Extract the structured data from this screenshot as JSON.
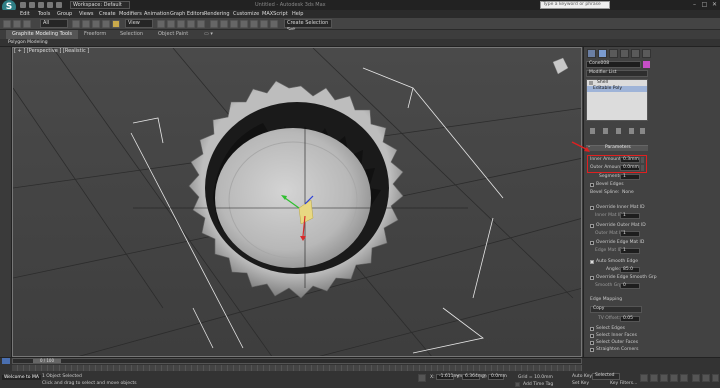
{
  "titlebar": {
    "workspace": "Workspace: Default",
    "title": "Untitled - Autodesk 3ds Max",
    "search_placeholder": "Type a keyword or phrase"
  },
  "menu": [
    "Edit",
    "Tools",
    "Group",
    "Views",
    "Create",
    "Modifiers",
    "Animation",
    "Graph Editors",
    "Rendering",
    "Customize",
    "MAXScript",
    "Help"
  ],
  "toolbar": {
    "filter": "All",
    "ref_coord": "View",
    "selection_set": "Create Selection Set"
  },
  "ribbon": {
    "tabs": [
      "Graphite Modeling Tools",
      "Freeform",
      "Selection",
      "Object Paint"
    ],
    "subtab": "Polygon Modeling"
  },
  "viewport": {
    "label": "[ + ] [Perspective ] [Realistic ]"
  },
  "command_panel": {
    "object_name": "Cone008",
    "modifier_list": "Modifier List",
    "stack": [
      "Shell",
      "Editable Poly"
    ],
    "rollout": "Parameters",
    "inner_amount_label": "Inner Amount:",
    "inner_amount": "0.3mm",
    "outer_amount_label": "Outer Amount:",
    "outer_amount": "0.0mm",
    "segments_label": "Segments:",
    "segments": "1",
    "bevel_edges": "Bevel Edges",
    "bevel_spline_label": "Bevel Spline:",
    "bevel_spline": "None",
    "override_inner": "Override Inner Mat ID",
    "inner_mat_label": "Inner Mat ID:",
    "inner_mat": "1",
    "override_outer": "Override Outer Mat ID",
    "outer_mat_label": "Outer Mat ID:",
    "outer_mat": "1",
    "override_edge": "Override Edge Mat ID",
    "edge_mat_label": "Edge Mat ID:",
    "edge_mat": "1",
    "auto_smooth": "Auto Smooth Edge",
    "angle_label": "Angle:",
    "angle": "85.0",
    "override_smooth": "Override Edge Smooth Grp",
    "smooth_grp_label": "Smooth Grp:",
    "smooth_grp": "0",
    "edge_mapping": "Edge Mapping",
    "edge_mapping_value": "Copy",
    "tv_offset_label": "TV Offset:",
    "tv_offset": "0.05",
    "select_edges": "Select Edges",
    "select_inner": "Select Inner Faces",
    "select_outer": "Select Outer Faces",
    "straighten": "Straighten Corners"
  },
  "status": {
    "time": "0 / 100",
    "welcome": "Welcome to MA",
    "selected": "1 Object Selected",
    "prompt": "Click and drag to select and move objects",
    "x_label": "X:",
    "x": "-1.611mm",
    "y_label": "Y:",
    "y": "6.364mm",
    "z_label": "Z:",
    "z": "0.0mm",
    "grid": "Grid = 10.0mm",
    "auto_key": "Auto Key",
    "add_time_tag": "Add Time Tag",
    "set_key": "Set Key",
    "key_mode": "Selected",
    "key_filters": "Key Filters..."
  }
}
